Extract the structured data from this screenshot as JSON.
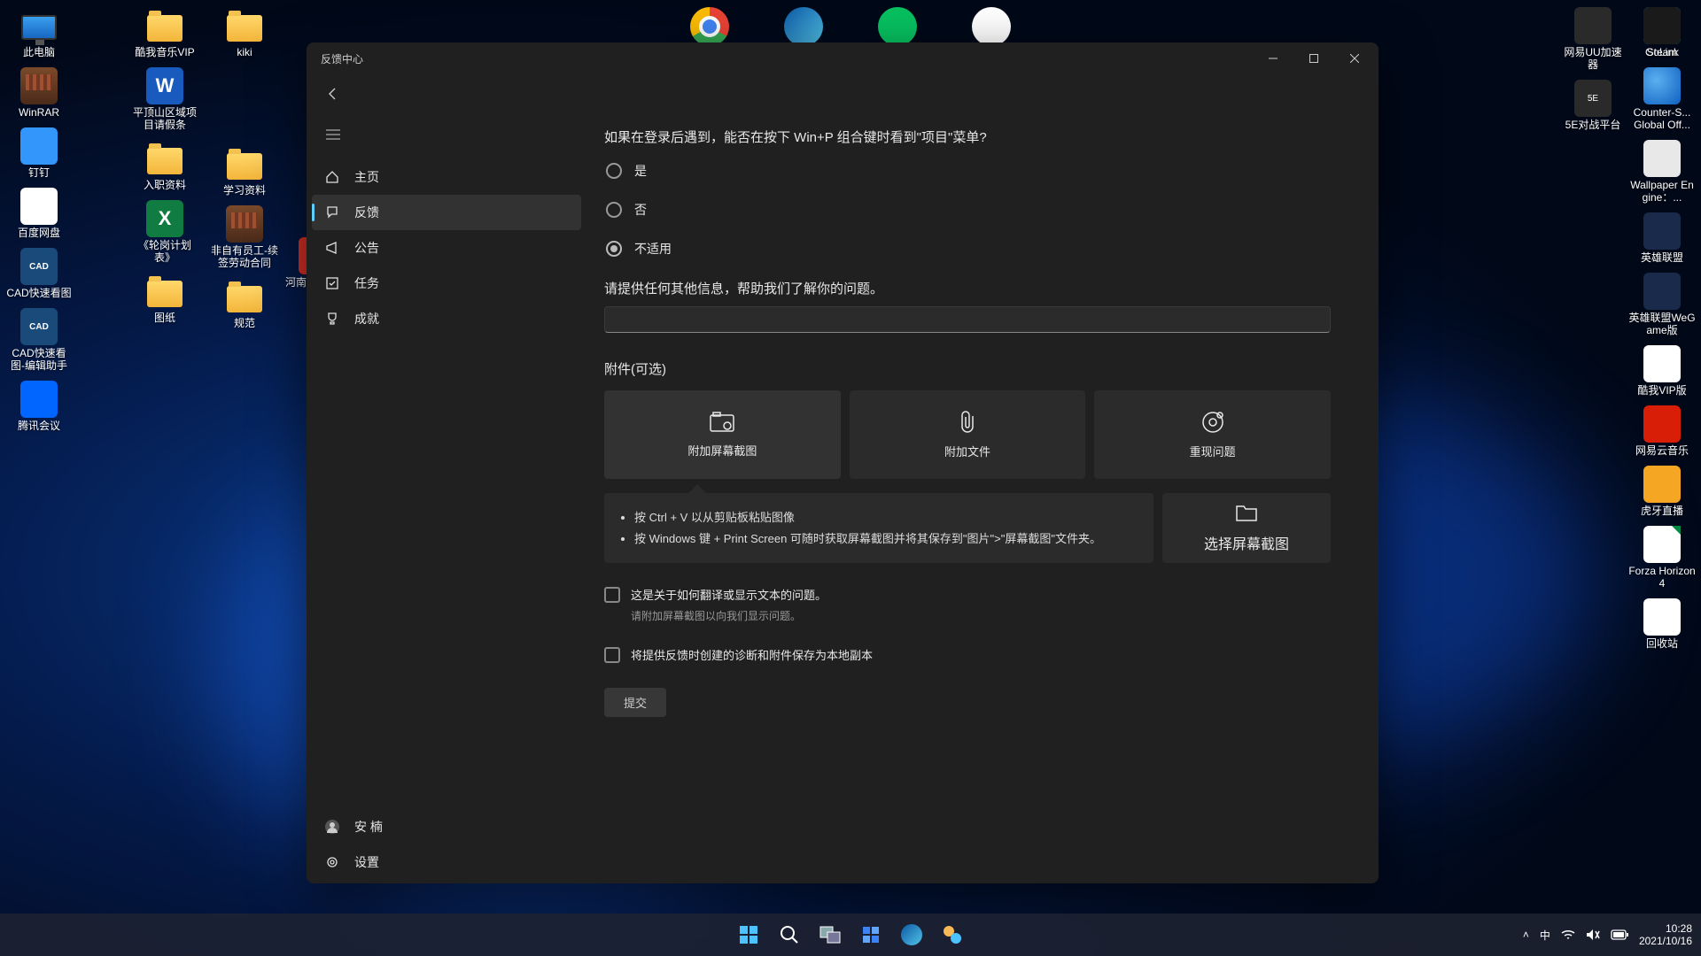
{
  "desktop": {
    "left_icons": [
      {
        "type": "monitor",
        "label": "此电脑"
      },
      {
        "type": "winrar",
        "label": "WinRAR"
      },
      {
        "type": "dingding",
        "label": "钉钉"
      },
      {
        "type": "baidu",
        "label": "百度网盘"
      },
      {
        "type": "cad",
        "label": "CAD快速看图"
      },
      {
        "type": "cad",
        "label": "CAD快速看图-编辑助手"
      },
      {
        "type": "tencent",
        "label": "腾讯会议"
      }
    ],
    "col2": [
      {
        "type": "folder",
        "label": "酷我音乐VIP"
      },
      {
        "type": "word",
        "label": "平顶山区域项目请假条"
      },
      {
        "type": "folder",
        "label": "入职资料"
      },
      {
        "type": "excel",
        "label": "《轮岗计划表》"
      },
      {
        "type": "folder",
        "label": "图纸"
      }
    ],
    "col3": [
      {
        "type": "folder",
        "label": "kiki"
      },
      {
        "type": "none",
        "label": ""
      },
      {
        "type": "folder",
        "label": "学习资料"
      },
      {
        "type": "winrar",
        "label": "非自有员工-续签劳动合同"
      },
      {
        "type": "folder",
        "label": "规范"
      }
    ],
    "col4": [
      {
        "type": "none",
        "label": ""
      },
      {
        "type": "none",
        "label": ""
      },
      {
        "type": "none",
        "label": ""
      },
      {
        "type": "pdf",
        "label": "河南分自有人"
      }
    ],
    "top_row": [
      "chrome",
      "edge",
      "wechat",
      "qq"
    ],
    "right_col2": [
      {
        "type": "uu",
        "label": "网易UU加速器"
      },
      {
        "type": "ee",
        "label": "5E对战平台"
      }
    ],
    "right_col1": [
      {
        "type": "golink",
        "label": "GoLink"
      },
      {
        "type": "globe",
        "label": "Counter-S... Global Off..."
      },
      {
        "type": "wall",
        "label": "Wallpaper Engine：..."
      },
      {
        "type": "lol",
        "label": "英雄联盟"
      },
      {
        "type": "lol",
        "label": "英雄联盟WeGame版"
      },
      {
        "type": "kuwo",
        "label": "酷我VIP版"
      },
      {
        "type": "netease",
        "label": "网易云音乐"
      },
      {
        "type": "huya",
        "label": "虎牙直播"
      },
      {
        "type": "fileic",
        "label": "Forza Horizon 4"
      },
      {
        "type": "bin",
        "label": "回收站"
      }
    ],
    "right_extra_1": {
      "type": "steam",
      "label": "Steam"
    }
  },
  "window": {
    "title": "反馈中心",
    "nav": {
      "home": "主页",
      "feedback": "反馈",
      "announce": "公告",
      "tasks": "任务",
      "achieve": "成就",
      "user": "安 楠",
      "settings": "设置"
    },
    "content": {
      "question": "如果在登录后遇到，能否在按下 Win+P 组合键时看到\"项目\"菜单?",
      "opt_yes": "是",
      "opt_no": "否",
      "opt_na": "不适用",
      "detail_label": "请提供任何其他信息，帮助我们了解你的问题。",
      "attach_title": "附件(可选)",
      "att_screenshot": "附加屏幕截图",
      "att_file": "附加文件",
      "att_repro": "重现问题",
      "tip1": "按 Ctrl + V 以从剪贴板粘贴图像",
      "tip2": "按 Windows 键 + Print Screen 可随时获取屏幕截图并将其保存到\"图片\">\"屏幕截图\"文件夹。",
      "choose": "选择屏幕截图",
      "chk1": "这是关于如何翻译或显示文本的问题。",
      "chk1_help": "请附加屏幕截图以向我们显示问题。",
      "chk2": "将提供反馈时创建的诊断和附件保存为本地副本",
      "submit": "提交"
    }
  },
  "taskbar": {
    "ime": "中",
    "time": "10:28",
    "date": "2021/10/16"
  }
}
